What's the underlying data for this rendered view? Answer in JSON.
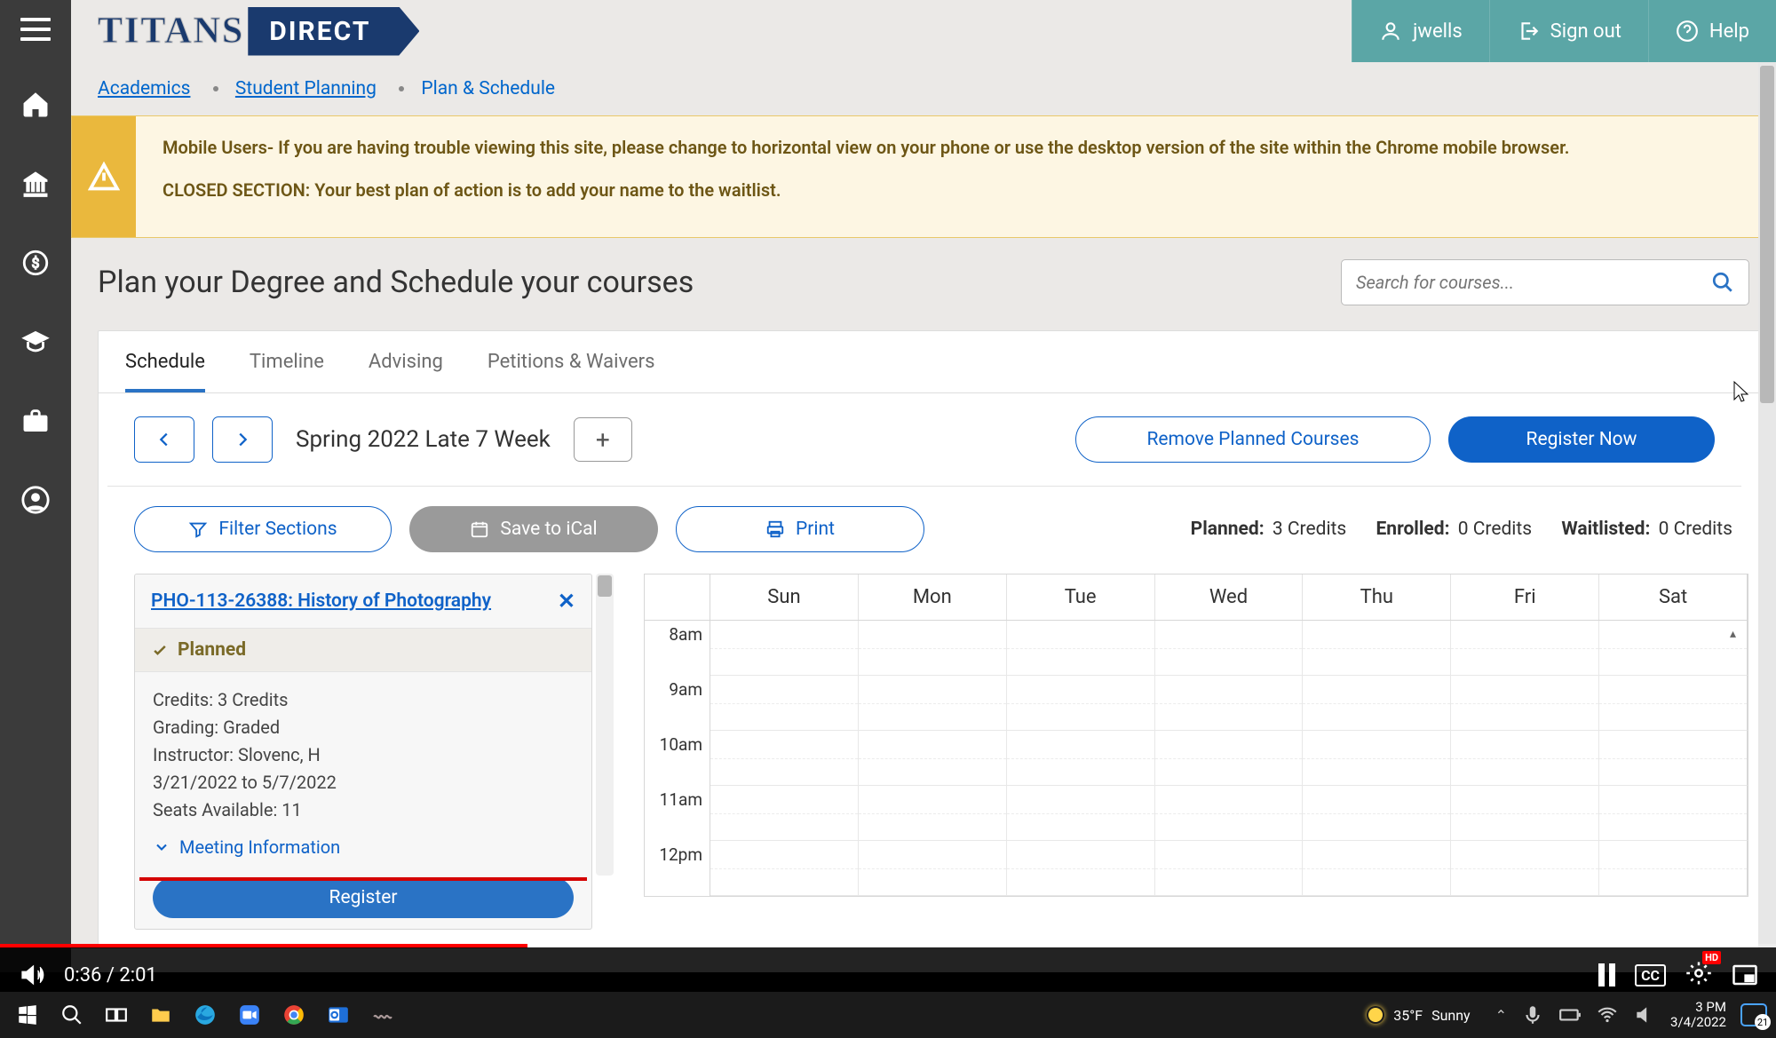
{
  "header": {
    "logo_main": "TITANS",
    "logo_sub": "DIRECT",
    "user": "jwells",
    "signout": "Sign out",
    "help": "Help"
  },
  "crumbs": {
    "a": "Academics",
    "b": "Student Planning",
    "c": "Plan & Schedule"
  },
  "warn": {
    "line1": "Mobile Users- If you are having trouble viewing this site, please change to horizontal view on your phone or use the desktop version of the site within the Chrome mobile browser.",
    "line2": "CLOSED SECTION: Your best plan of action is to add your name to the waitlist."
  },
  "title": "Plan your Degree and Schedule your courses",
  "search_ph": "Search for courses...",
  "tabs": [
    "Schedule",
    "Timeline",
    "Advising",
    "Petitions & Waivers"
  ],
  "term": "Spring 2022 Late 7 Week",
  "actions": {
    "remove": "Remove Planned Courses",
    "register_now": "Register Now"
  },
  "filters": {
    "filter": "Filter Sections",
    "ical": "Save to iCal",
    "print": "Print"
  },
  "credits": {
    "planned_l": "Planned:",
    "planned_v": "3 Credits",
    "enrolled_l": "Enrolled:",
    "enrolled_v": "0 Credits",
    "wait_l": "Waitlisted:",
    "wait_v": "0 Credits"
  },
  "course": {
    "title": "PHO-113-26388: History of Photography",
    "status": "Planned",
    "credits": "Credits: 3 Credits",
    "grading": "Grading: Graded",
    "instructor": "Instructor: Slovenc, H",
    "dates": "3/21/2022 to 5/7/2022",
    "seats": "Seats Available:  11",
    "meeting": "Meeting Information",
    "register": "Register"
  },
  "cal": {
    "days": [
      "Sun",
      "Mon",
      "Tue",
      "Wed",
      "Thu",
      "Fri",
      "Sat"
    ],
    "times": [
      "8am",
      "9am",
      "10am",
      "11am",
      "12pm"
    ]
  },
  "video": {
    "cur": "0:36",
    "total": "2:01",
    "cc": "CC",
    "hd": "HD"
  },
  "taskbar": {
    "temp": "35°F",
    "cond": "Sunny",
    "time": "3 PM",
    "date": "3/4/2022",
    "notif": "21"
  }
}
